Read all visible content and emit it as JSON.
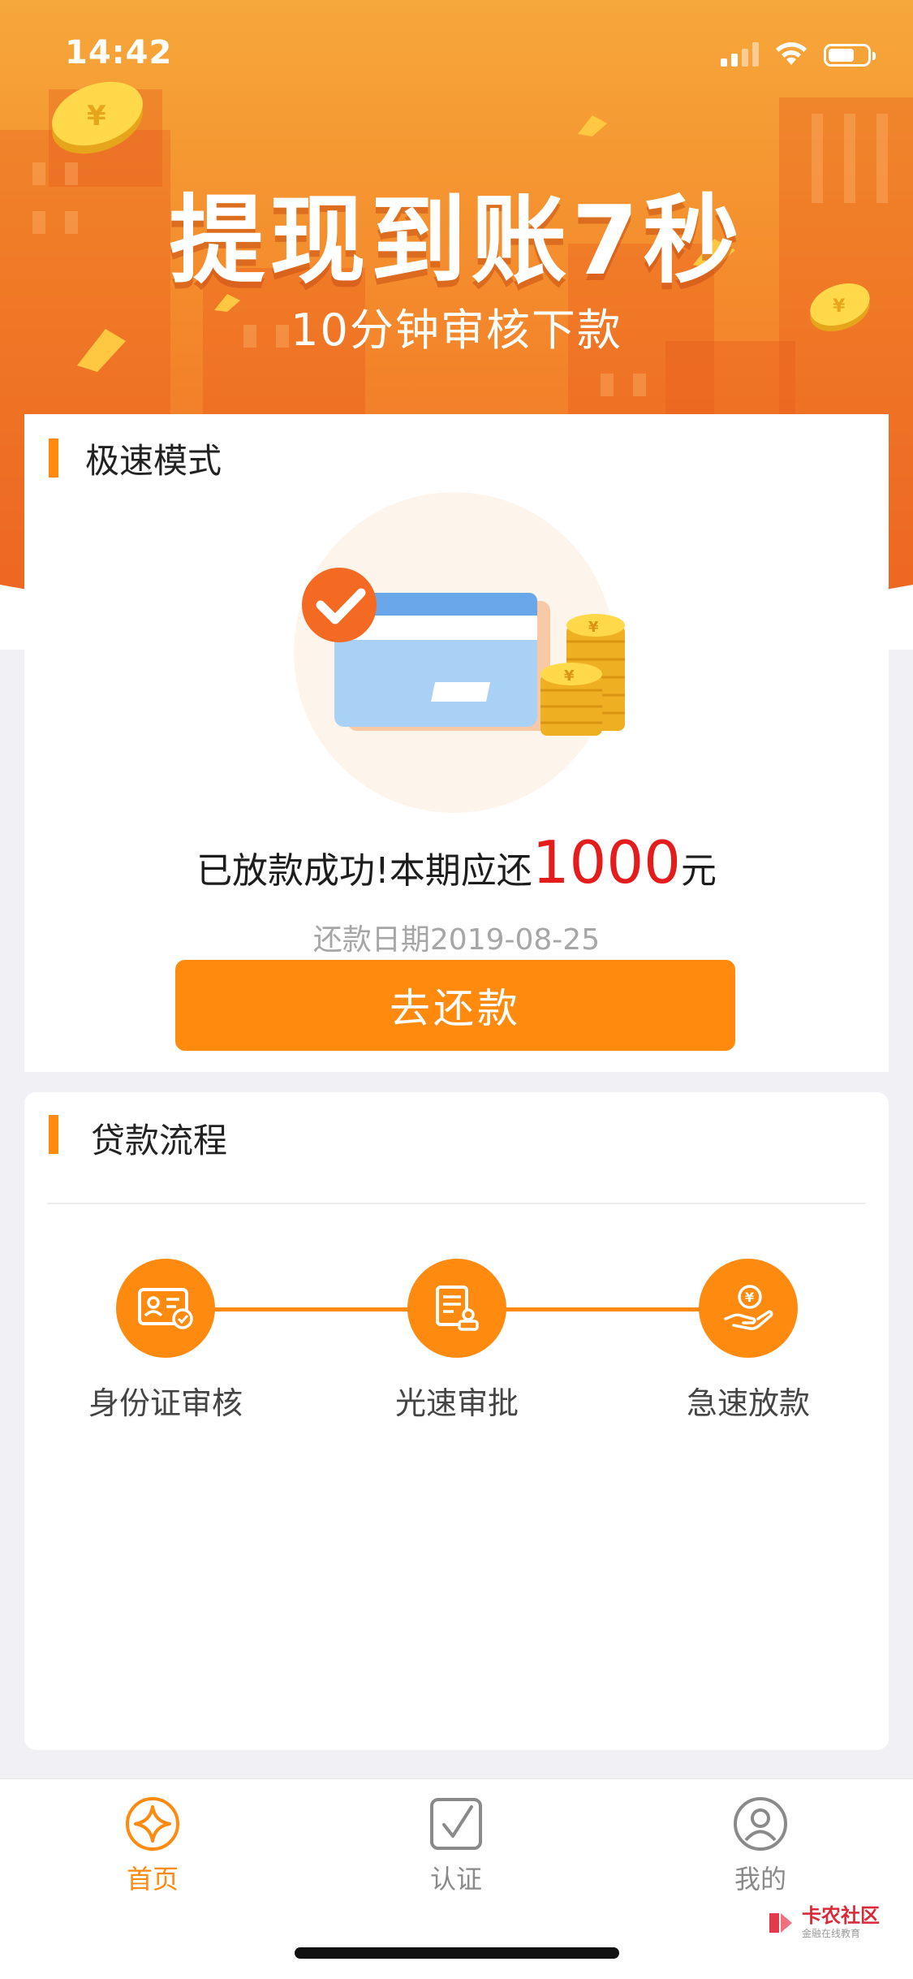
{
  "status_bar": {
    "time": "14:42"
  },
  "hero": {
    "title": "提现到账7秒",
    "subtitle": "10分钟审核下款"
  },
  "speed_mode": {
    "title": "极速模式",
    "message_prefix": "已放款成功!本期应还",
    "amount": "1000",
    "unit": "元",
    "date_label": "还款日期2019-08-25",
    "repay_button": "去还款"
  },
  "loan_process": {
    "title": "贷款流程",
    "steps": [
      {
        "label": "身份证审核",
        "icon": "id-card-check-icon"
      },
      {
        "label": "光速审批",
        "icon": "document-approve-icon"
      },
      {
        "label": "急速放款",
        "icon": "hand-yuan-coin-icon"
      }
    ]
  },
  "tabbar": {
    "items": [
      {
        "label": "首页",
        "icon": "sparkle-home-icon",
        "active": true
      },
      {
        "label": "认证",
        "icon": "checkbox-icon",
        "active": false
      },
      {
        "label": "我的",
        "icon": "user-profile-icon",
        "active": false
      }
    ]
  },
  "watermark": {
    "text": "卡农社区",
    "sub": "金融在线教育"
  },
  "colors": {
    "accent": "#ff8a10",
    "amount": "#e51c1c",
    "hero_top": "#f6a83a",
    "hero_bottom": "#f06a24"
  }
}
